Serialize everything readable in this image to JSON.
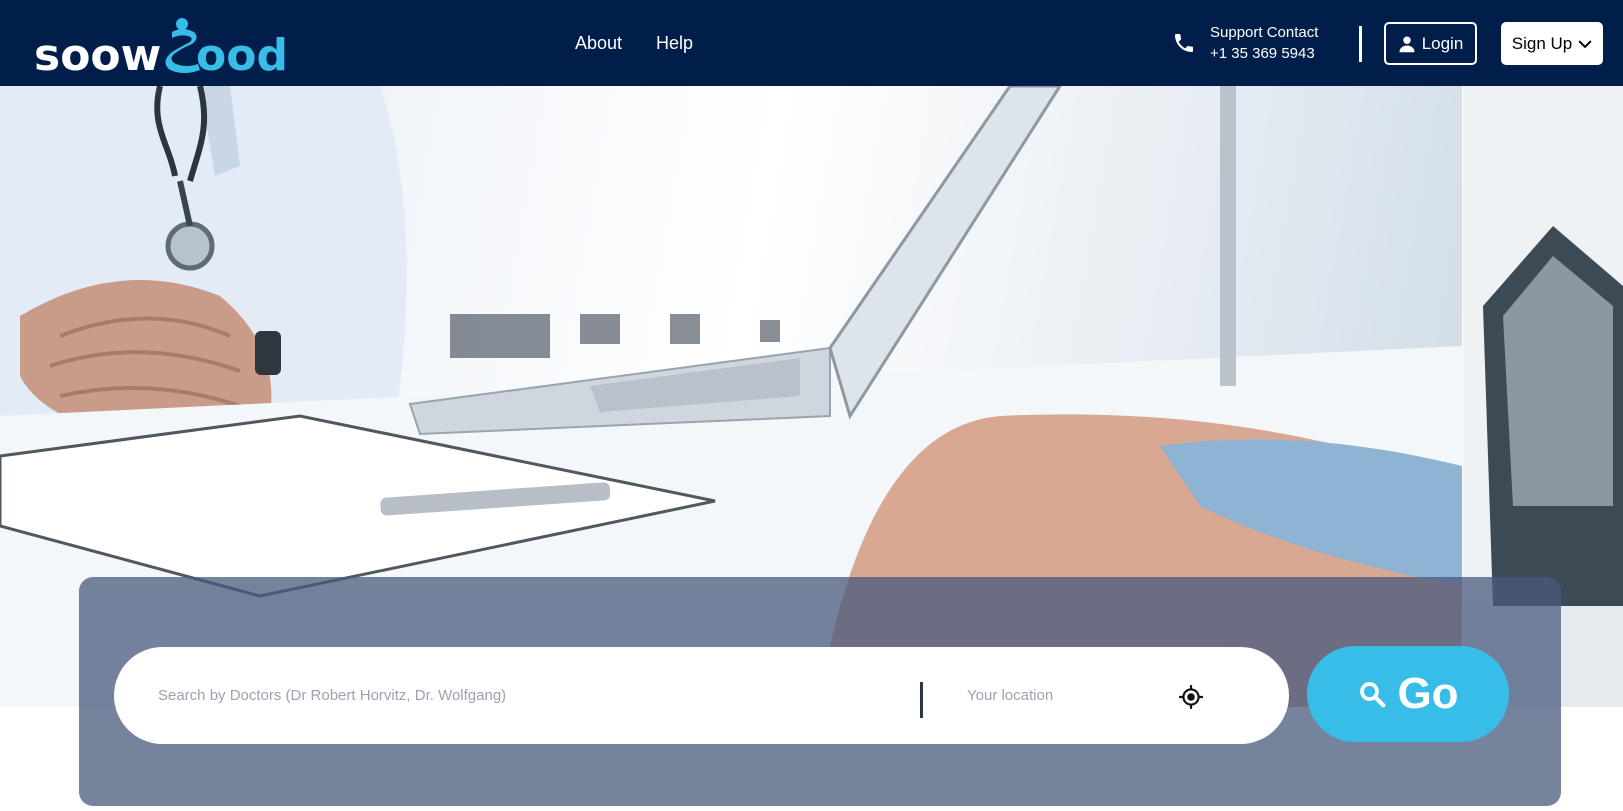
{
  "brand": {
    "logo_text": "soowGood",
    "logo_color": "#38bde9"
  },
  "nav": {
    "items": [
      {
        "label": "About"
      },
      {
        "label": "Help"
      }
    ]
  },
  "support": {
    "title": "Support Contact",
    "phone": "+1 35 369 5943",
    "icon": "phone-icon"
  },
  "auth": {
    "login_label": "Login",
    "signup_label": "Sign Up"
  },
  "search": {
    "doctor_placeholder": "Search by Doctors (Dr Robert Horvitz, Dr. Wolfgang)",
    "location_placeholder": "Your location",
    "go_label": "Go"
  },
  "colors": {
    "header_bg": "#011e4b",
    "accent": "#38bde9",
    "panel_bg": "rgba(72,90,124,0.75)"
  }
}
